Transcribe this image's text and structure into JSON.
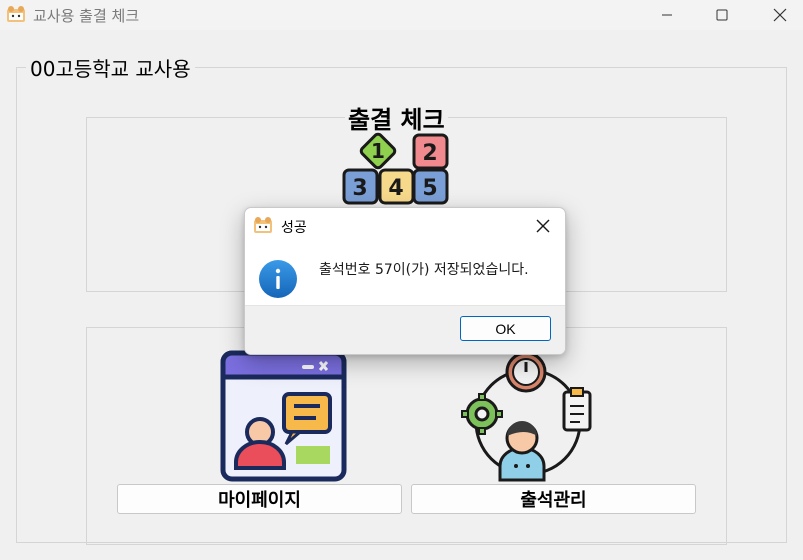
{
  "window": {
    "title": "교사용 출결 체크",
    "app_icon": "hamster-icon"
  },
  "main": {
    "group_title": "00고등학교 교사용",
    "heading": "출결 체크",
    "blocks_icon": "number-blocks-icon",
    "blocks_numbers": [
      "1",
      "2",
      "3",
      "4",
      "5"
    ],
    "mypage_button_label": "마이페이지",
    "attendance_button_label": "출석관리"
  },
  "dialog": {
    "title": "성공",
    "message": "출석번호 57이(가) 저장되었습니다.",
    "ok_label": "OK",
    "icon": "info-icon"
  },
  "colors": {
    "dialog_accent": "#0067c0",
    "info_icon": "#1f7fd4"
  }
}
